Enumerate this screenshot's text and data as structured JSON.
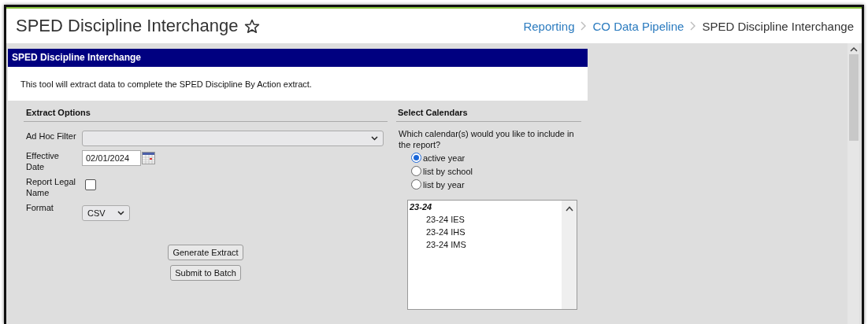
{
  "page": {
    "title": "SPED Discipline Interchange",
    "favorite": false
  },
  "breadcrumbs": [
    {
      "label": "Reporting",
      "kind": "link"
    },
    {
      "label": "CO Data Pipeline",
      "kind": "link"
    },
    {
      "label": "SPED Discipline Interchange",
      "kind": "current"
    }
  ],
  "panel": {
    "title": "SPED Discipline Interchange",
    "description": "This tool will extract data to complete the SPED Discipline By Action extract."
  },
  "extract_options": {
    "heading": "Extract Options",
    "fields": [
      {
        "kind": "select",
        "label": "Ad Hoc Filter"
      },
      {
        "kind": "date",
        "label": "Effective Date",
        "value": "02/01/2024"
      },
      {
        "kind": "checkbox",
        "label": "Report Legal Name",
        "checked": false
      },
      {
        "kind": "small-select",
        "label": "Format",
        "value": "CSV"
      }
    ],
    "buttons": [
      "Generate Extract",
      "Submit to Batch"
    ]
  },
  "calendars": {
    "heading": "Select Calendars",
    "question": "Which calendar(s) would you like to include in the report?",
    "options": [
      {
        "label": "active year",
        "selected": true
      },
      {
        "label": "list by school",
        "selected": false
      },
      {
        "label": "list by year",
        "selected": false
      }
    ],
    "list": [
      {
        "label": "23-24",
        "children": [
          {
            "label": "23-24 IES"
          },
          {
            "label": "23-24 IHS"
          },
          {
            "label": "23-24 IMS"
          }
        ]
      }
    ]
  }
}
